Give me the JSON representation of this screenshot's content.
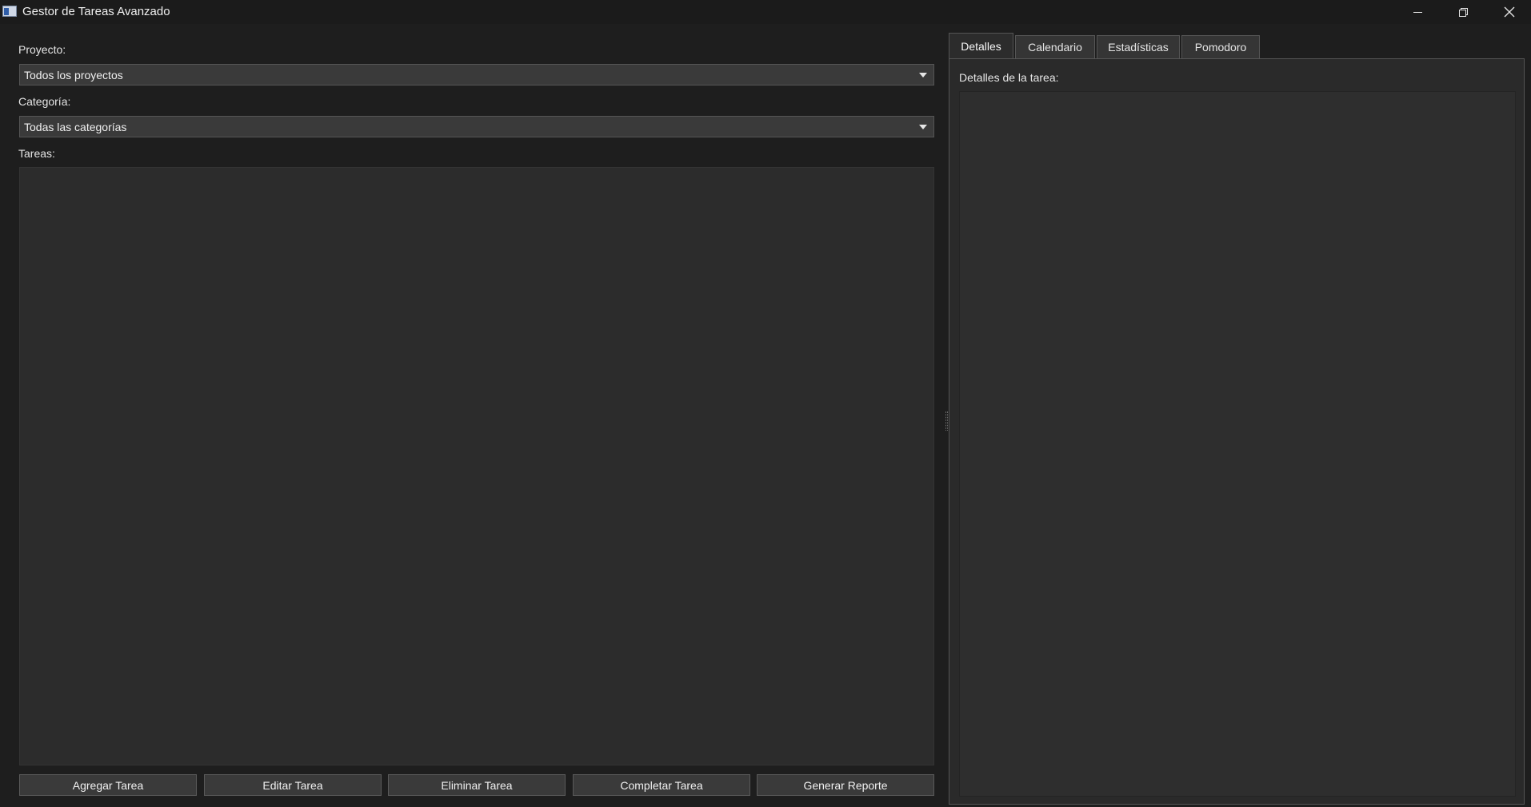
{
  "window": {
    "title": "Gestor de Tareas Avanzado",
    "controls": [
      "minimize",
      "restore",
      "close"
    ]
  },
  "filters": {
    "project_label": "Proyecto:",
    "project_value": "Todos los proyectos",
    "category_label": "Categoría:",
    "category_value": "Todas las categorías"
  },
  "tasks": {
    "label": "Tareas:",
    "items": []
  },
  "actions": {
    "add": "Agregar Tarea",
    "edit": "Editar Tarea",
    "delete": "Eliminar Tarea",
    "complete": "Completar Tarea",
    "report": "Generar Reporte"
  },
  "tabs": {
    "details": "Detalles",
    "calendar": "Calendario",
    "stats": "Estadísticas",
    "pomodoro": "Pomodoro",
    "active": "Detalles"
  },
  "details": {
    "label": "Detalles de la tarea:",
    "content": ""
  },
  "colors": {
    "background": "#1e1e1e",
    "panel": "#2c2c2c",
    "control": "#3a3a3a",
    "text": "#e6e6e6"
  }
}
